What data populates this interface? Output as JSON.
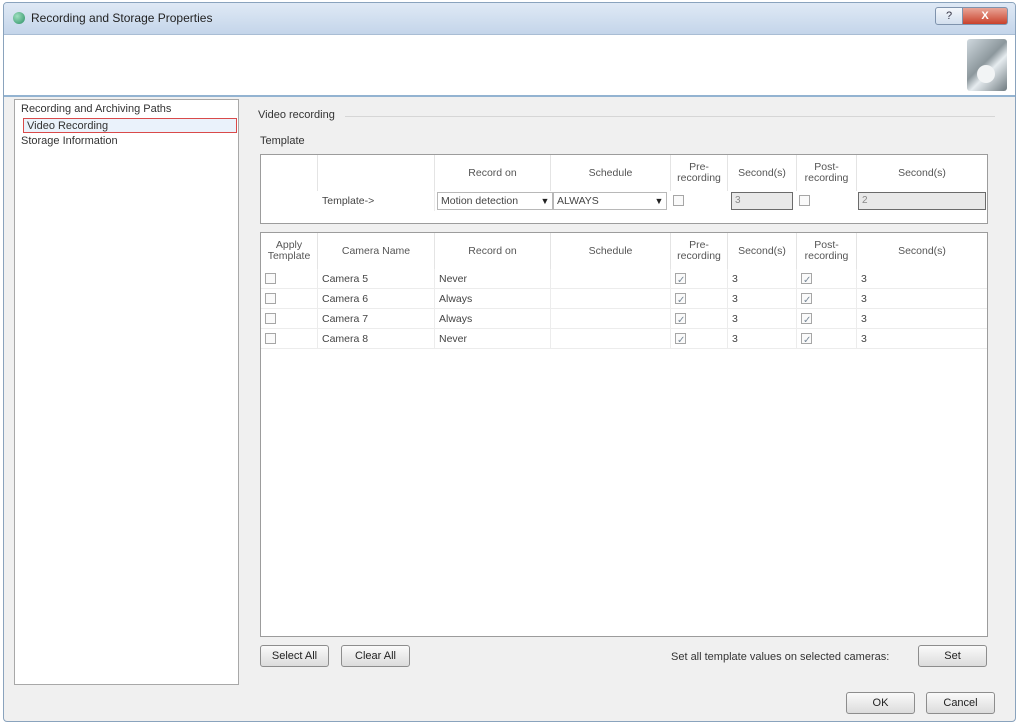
{
  "window": {
    "title": "Recording and Storage Properties",
    "help_label": "?",
    "close_label": "X"
  },
  "nav": {
    "items": [
      "Recording and Archiving Paths",
      "Video Recording",
      "Storage Information"
    ]
  },
  "section": {
    "group_title": "Video recording",
    "template_label": "Template"
  },
  "columns": {
    "apply_template": "Apply Template",
    "camera_name": "Camera Name",
    "record_on": "Record on",
    "schedule": "Schedule",
    "pre_recording": "Pre-recording",
    "seconds": "Second(s)",
    "post_recording": "Post-recording"
  },
  "template_row": {
    "label": "Template->",
    "record_on": "Motion detection",
    "schedule": "ALWAYS",
    "pre_checked": false,
    "pre_seconds": "3",
    "post_checked": false,
    "post_seconds": "2"
  },
  "cameras": [
    {
      "apply": false,
      "name": "Camera 5",
      "record_on": "Never",
      "schedule": "",
      "pre": true,
      "pre_seconds": "3",
      "post": true,
      "post_seconds": "3"
    },
    {
      "apply": false,
      "name": "Camera 6",
      "record_on": "Always",
      "schedule": "",
      "pre": true,
      "pre_seconds": "3",
      "post": true,
      "post_seconds": "3"
    },
    {
      "apply": false,
      "name": "Camera 7",
      "record_on": "Always",
      "schedule": "",
      "pre": true,
      "pre_seconds": "3",
      "post": true,
      "post_seconds": "3"
    },
    {
      "apply": false,
      "name": "Camera 8",
      "record_on": "Never",
      "schedule": "",
      "pre": true,
      "pre_seconds": "3",
      "post": true,
      "post_seconds": "3"
    }
  ],
  "buttons": {
    "select_all": "Select All",
    "clear_all": "Clear All",
    "set_text": "Set all template values on selected cameras:",
    "set": "Set",
    "ok": "OK",
    "cancel": "Cancel"
  }
}
